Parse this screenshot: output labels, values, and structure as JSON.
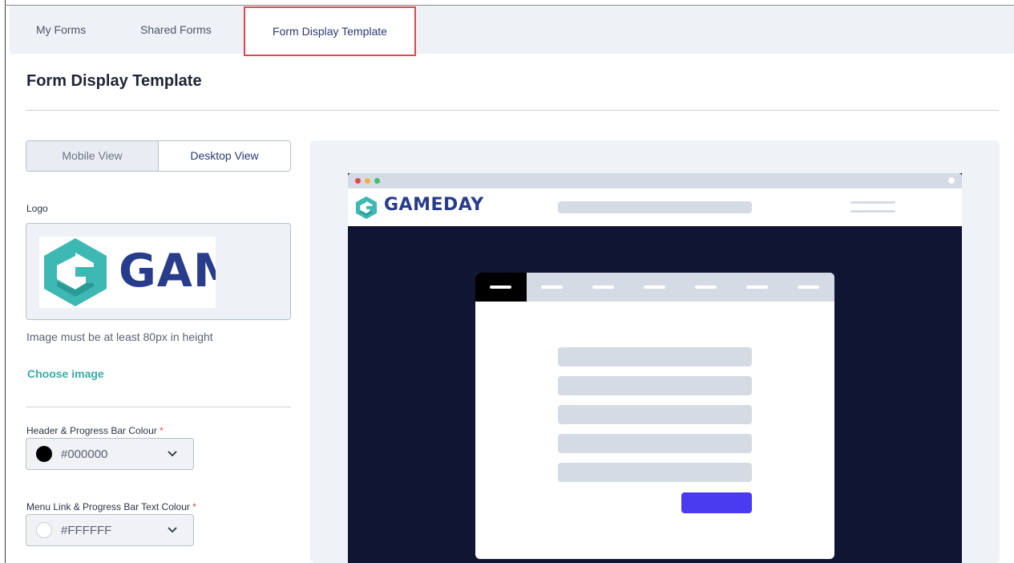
{
  "tabs": [
    {
      "label": "My Forms"
    },
    {
      "label": "Shared Forms"
    },
    {
      "label": "Form Display Template"
    }
  ],
  "page_title": "Form Display Template",
  "view_toggle": {
    "mobile": "Mobile View",
    "desktop": "Desktop View",
    "selected": "Desktop View"
  },
  "logo": {
    "label": "Logo",
    "brand_text": "GAMEDAY",
    "hint": "Image must be at least 80px in height",
    "choose_link": "Choose image"
  },
  "header_colour": {
    "label": "Header & Progress Bar Colour",
    "required_mark": "*",
    "value": "#000000",
    "swatch": "#000000"
  },
  "menu_colour": {
    "label": "Menu Link & Progress Bar Text Colour",
    "required_mark": "*",
    "value": "#FFFFFF",
    "swatch": "#FFFFFF"
  },
  "preview": {
    "site_name": "GAMEDAY",
    "brand_color": "#283c8c",
    "accent_color": "#3db8b3",
    "submit_color": "#4a3af0",
    "page_bg": "#0f1533"
  }
}
